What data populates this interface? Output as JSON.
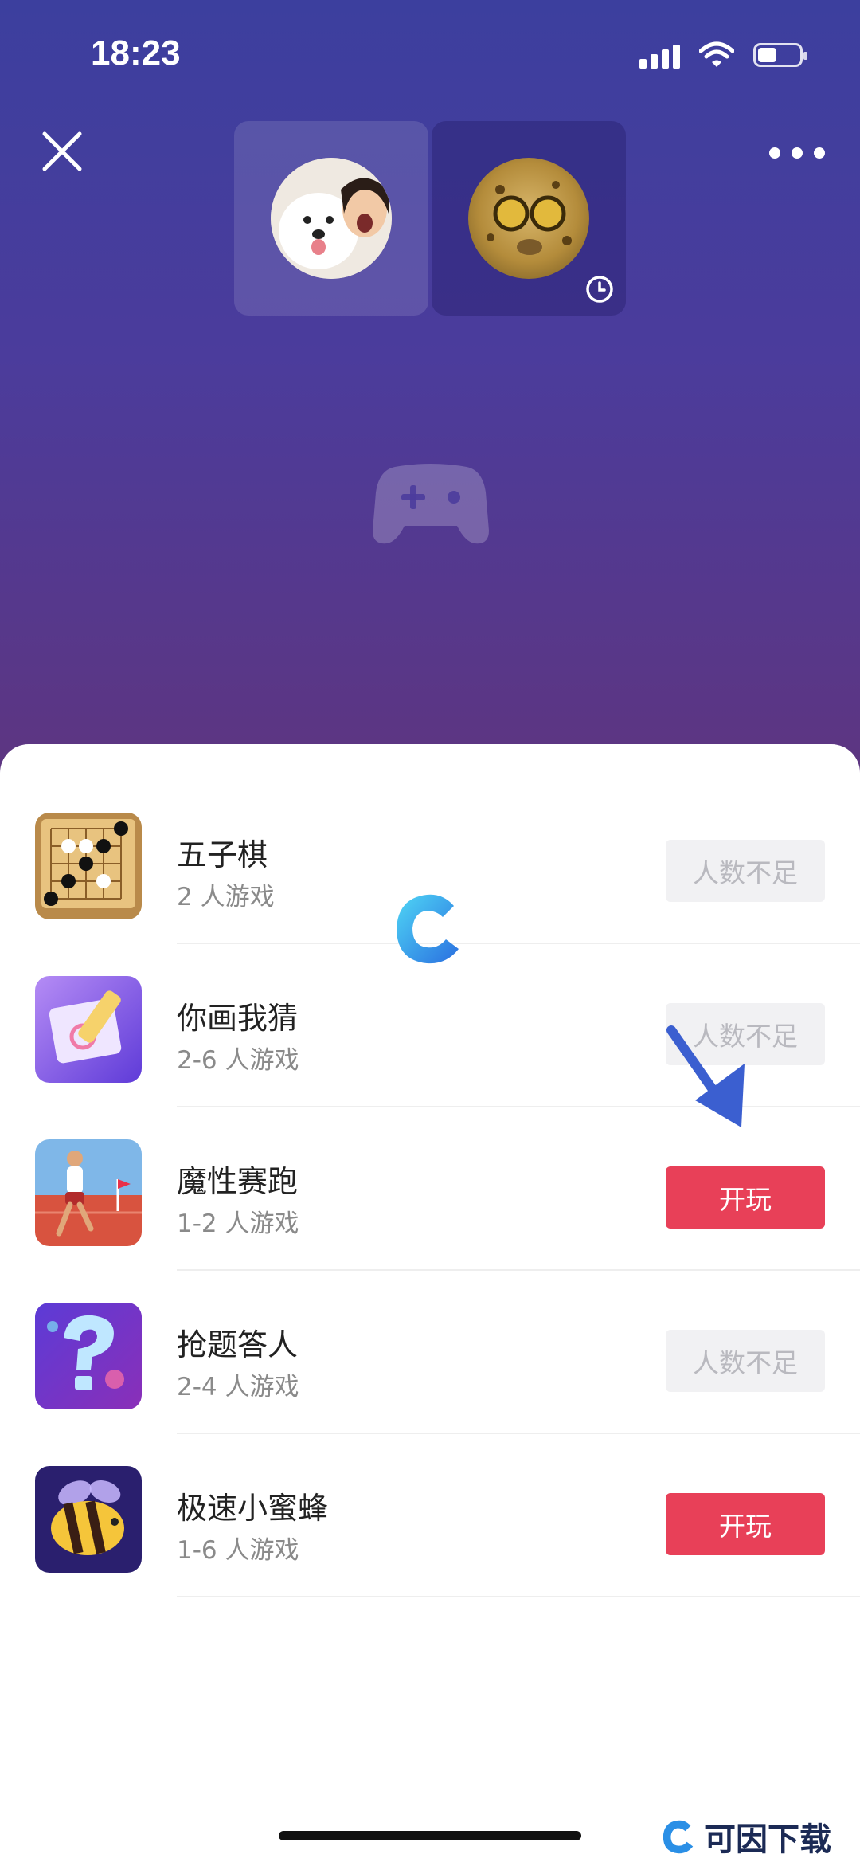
{
  "status_bar": {
    "time": "18:23",
    "battery_level": 0.45
  },
  "colors": {
    "accent": "#e84058",
    "disabled_bg": "#f1f1f3",
    "header_top": "#3c3f9e",
    "header_bottom": "#5e3580"
  },
  "header": {
    "close_icon": "close-icon",
    "more_icon": "more-icon"
  },
  "users": [
    {
      "avatar": "dog-selfie-avatar"
    },
    {
      "avatar": "leopard-avatar",
      "badge_icon": "clock-icon"
    }
  ],
  "center_icon": "gamepad-icon",
  "games": [
    {
      "name": "五子棋",
      "players": "2 人游戏",
      "action": "人数不足",
      "enabled": false,
      "icon": "gomoku-icon"
    },
    {
      "name": "你画我猜",
      "players": "2-6 人游戏",
      "action": "人数不足",
      "enabled": false,
      "icon": "draw-guess-icon"
    },
    {
      "name": "魔性赛跑",
      "players": "1-2 人游戏",
      "action": "开玩",
      "enabled": true,
      "icon": "runner-icon"
    },
    {
      "name": "抢题答人",
      "players": "2-4 人游戏",
      "action": "人数不足",
      "enabled": false,
      "icon": "quiz-icon"
    },
    {
      "name": "极速小蜜蜂",
      "players": "1-6 人游戏",
      "action": "开玩",
      "enabled": true,
      "icon": "bee-icon"
    }
  ],
  "watermark": {
    "brand": "可因下载"
  }
}
